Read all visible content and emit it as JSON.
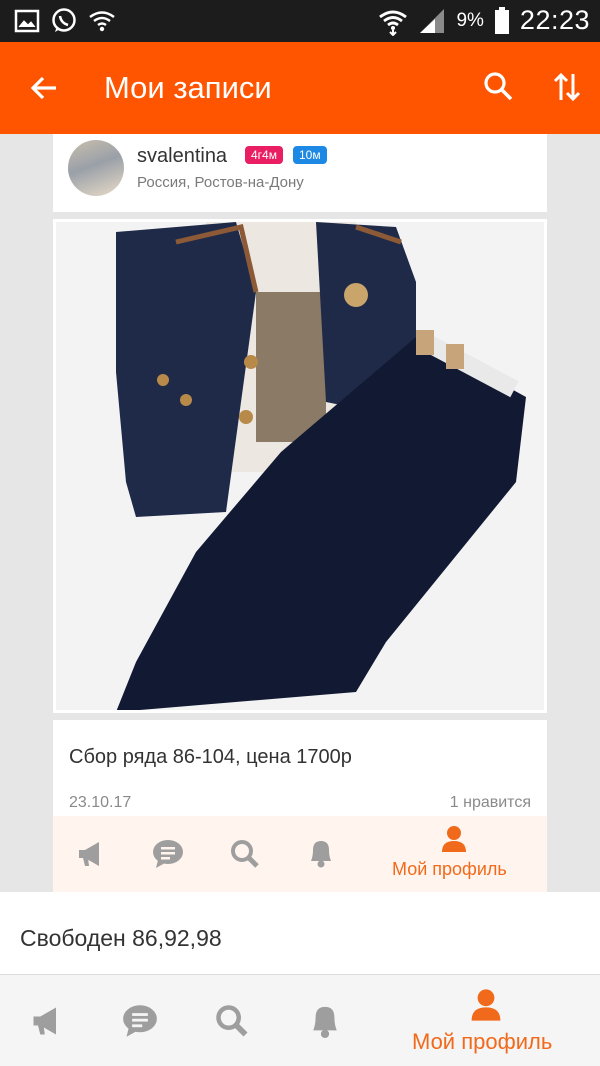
{
  "status_bar": {
    "battery_percent": "9%",
    "time": "22:23",
    "icons": [
      "gallery-icon",
      "whatsapp-icon",
      "wifi-question-icon",
      "wifi-icon",
      "signal-icon",
      "battery-icon"
    ]
  },
  "app_bar": {
    "title": "Мои записи",
    "icons": [
      "back-arrow-icon",
      "search-icon",
      "sort-icon"
    ]
  },
  "post": {
    "author": {
      "username": "svalentina",
      "badges": [
        "4г4м",
        "10м"
      ],
      "location": "Россия, Ростов-на-Дону"
    },
    "caption": "Сбор ряда 86-104, цена 1700р",
    "date": "23.10.17",
    "likes": "1 нравится"
  },
  "nav": {
    "items": [
      {
        "icon": "megaphone-icon"
      },
      {
        "icon": "chat-icon"
      },
      {
        "icon": "search-icon"
      },
      {
        "icon": "bell-icon"
      },
      {
        "icon": "profile-icon",
        "label": "Мой профиль",
        "active": true
      }
    ]
  },
  "status_strip": {
    "text": "Свободен 86,92,98"
  },
  "colors": {
    "accent": "#ff5500",
    "nav_active": "#f16a1b",
    "nav_inactive": "#9e9e9e",
    "badge_pink": "#e91e63",
    "badge_blue": "#1e88e5"
  }
}
